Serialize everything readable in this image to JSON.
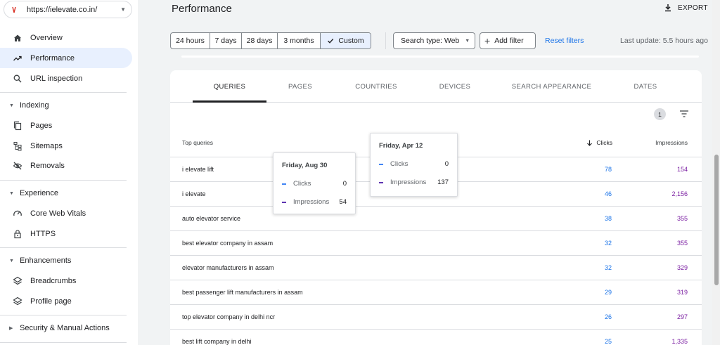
{
  "property": {
    "url": "https://ielevate.co.in/"
  },
  "sidebar": {
    "items": [
      {
        "label": "Overview"
      },
      {
        "label": "Performance"
      },
      {
        "label": "URL inspection"
      }
    ],
    "sections": [
      {
        "title": "Indexing",
        "items": [
          "Pages",
          "Sitemaps",
          "Removals"
        ]
      },
      {
        "title": "Experience",
        "items": [
          "Core Web Vitals",
          "HTTPS"
        ]
      },
      {
        "title": "Enhancements",
        "items": [
          "Breadcrumbs",
          "Profile page"
        ]
      },
      {
        "title": "Security & Manual Actions"
      }
    ]
  },
  "header": {
    "title": "Performance",
    "export_label": "EXPORT"
  },
  "toolbar": {
    "date_ranges": [
      "24 hours",
      "7 days",
      "28 days",
      "3 months",
      "Custom"
    ],
    "selected_range": "Custom",
    "search_type": "Search type: Web",
    "add_filter": "Add filter",
    "reset": "Reset filters",
    "last_update": "Last update: 5.5 hours ago"
  },
  "tabs": [
    "QUERIES",
    "PAGES",
    "COUNTRIES",
    "DEVICES",
    "SEARCH APPEARANCE",
    "DATES"
  ],
  "active_tab": "QUERIES",
  "filter_count": "1",
  "table": {
    "col_query": "Top queries",
    "col_clicks": "Clicks",
    "col_impressions": "Impressions",
    "rows": [
      {
        "query": "i elevate lift",
        "clicks": "78",
        "impressions": "154"
      },
      {
        "query": "i elevate",
        "clicks": "46",
        "impressions": "2,156"
      },
      {
        "query": "auto elevator service",
        "clicks": "38",
        "impressions": "355"
      },
      {
        "query": "best elevator company in assam",
        "clicks": "32",
        "impressions": "355"
      },
      {
        "query": "elevator manufacturers in assam",
        "clicks": "32",
        "impressions": "329"
      },
      {
        "query": "best passenger lift manufacturers in assam",
        "clicks": "29",
        "impressions": "319"
      },
      {
        "query": "top elevator company in delhi ncr",
        "clicks": "26",
        "impressions": "297"
      },
      {
        "query": "best lift company in delhi",
        "clicks": "25",
        "impressions": "1,335"
      }
    ]
  },
  "tooltips": [
    {
      "date": "Friday, Aug 30",
      "clicks_label": "Clicks",
      "clicks": "0",
      "impressions_label": "Impressions",
      "impressions": "54"
    },
    {
      "date": "Friday, Apr 12",
      "clicks_label": "Clicks",
      "clicks": "0",
      "impressions_label": "Impressions",
      "impressions": "137"
    }
  ],
  "colors": {
    "accent": "#1a73e8",
    "clicks": "#4285f4",
    "impressions": "#5e35b1",
    "active_nav": "#e8f0fe"
  }
}
